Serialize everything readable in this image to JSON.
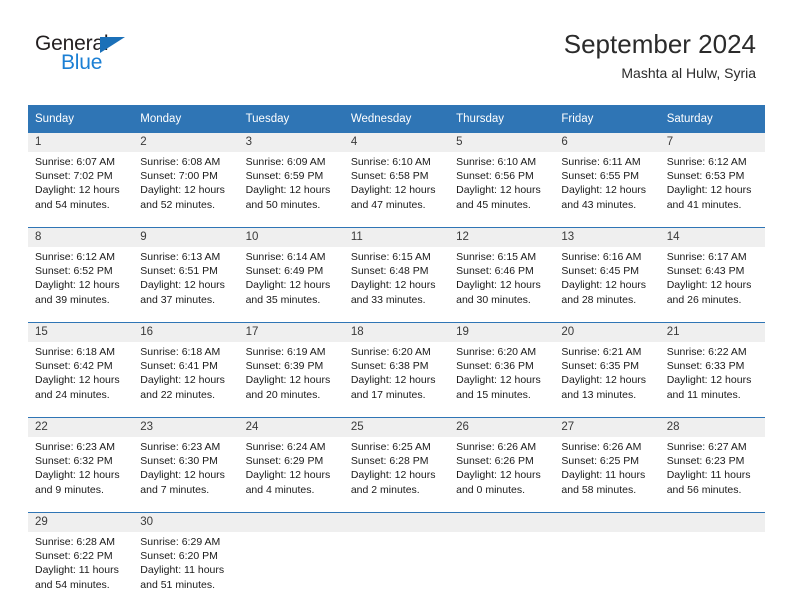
{
  "brand": {
    "name_top": "General",
    "name_bottom": "Blue"
  },
  "header": {
    "month_title": "September 2024",
    "location": "Mashta al Hulw, Syria"
  },
  "colors": {
    "header_blue": "#2f75b5",
    "logo_blue": "#1b7fd4",
    "daynum_band": "#efefef",
    "text": "#1a1a1a"
  },
  "calendar": {
    "weekday_headers": [
      "Sunday",
      "Monday",
      "Tuesday",
      "Wednesday",
      "Thursday",
      "Friday",
      "Saturday"
    ],
    "weeks": [
      {
        "days": [
          {
            "num": "1",
            "sunrise": "Sunrise: 6:07 AM",
            "sunset": "Sunset: 7:02 PM",
            "daylight1": "Daylight: 12 hours",
            "daylight2": "and 54 minutes."
          },
          {
            "num": "2",
            "sunrise": "Sunrise: 6:08 AM",
            "sunset": "Sunset: 7:00 PM",
            "daylight1": "Daylight: 12 hours",
            "daylight2": "and 52 minutes."
          },
          {
            "num": "3",
            "sunrise": "Sunrise: 6:09 AM",
            "sunset": "Sunset: 6:59 PM",
            "daylight1": "Daylight: 12 hours",
            "daylight2": "and 50 minutes."
          },
          {
            "num": "4",
            "sunrise": "Sunrise: 6:10 AM",
            "sunset": "Sunset: 6:58 PM",
            "daylight1": "Daylight: 12 hours",
            "daylight2": "and 47 minutes."
          },
          {
            "num": "5",
            "sunrise": "Sunrise: 6:10 AM",
            "sunset": "Sunset: 6:56 PM",
            "daylight1": "Daylight: 12 hours",
            "daylight2": "and 45 minutes."
          },
          {
            "num": "6",
            "sunrise": "Sunrise: 6:11 AM",
            "sunset": "Sunset: 6:55 PM",
            "daylight1": "Daylight: 12 hours",
            "daylight2": "and 43 minutes."
          },
          {
            "num": "7",
            "sunrise": "Sunrise: 6:12 AM",
            "sunset": "Sunset: 6:53 PM",
            "daylight1": "Daylight: 12 hours",
            "daylight2": "and 41 minutes."
          }
        ]
      },
      {
        "days": [
          {
            "num": "8",
            "sunrise": "Sunrise: 6:12 AM",
            "sunset": "Sunset: 6:52 PM",
            "daylight1": "Daylight: 12 hours",
            "daylight2": "and 39 minutes."
          },
          {
            "num": "9",
            "sunrise": "Sunrise: 6:13 AM",
            "sunset": "Sunset: 6:51 PM",
            "daylight1": "Daylight: 12 hours",
            "daylight2": "and 37 minutes."
          },
          {
            "num": "10",
            "sunrise": "Sunrise: 6:14 AM",
            "sunset": "Sunset: 6:49 PM",
            "daylight1": "Daylight: 12 hours",
            "daylight2": "and 35 minutes."
          },
          {
            "num": "11",
            "sunrise": "Sunrise: 6:15 AM",
            "sunset": "Sunset: 6:48 PM",
            "daylight1": "Daylight: 12 hours",
            "daylight2": "and 33 minutes."
          },
          {
            "num": "12",
            "sunrise": "Sunrise: 6:15 AM",
            "sunset": "Sunset: 6:46 PM",
            "daylight1": "Daylight: 12 hours",
            "daylight2": "and 30 minutes."
          },
          {
            "num": "13",
            "sunrise": "Sunrise: 6:16 AM",
            "sunset": "Sunset: 6:45 PM",
            "daylight1": "Daylight: 12 hours",
            "daylight2": "and 28 minutes."
          },
          {
            "num": "14",
            "sunrise": "Sunrise: 6:17 AM",
            "sunset": "Sunset: 6:43 PM",
            "daylight1": "Daylight: 12 hours",
            "daylight2": "and 26 minutes."
          }
        ]
      },
      {
        "days": [
          {
            "num": "15",
            "sunrise": "Sunrise: 6:18 AM",
            "sunset": "Sunset: 6:42 PM",
            "daylight1": "Daylight: 12 hours",
            "daylight2": "and 24 minutes."
          },
          {
            "num": "16",
            "sunrise": "Sunrise: 6:18 AM",
            "sunset": "Sunset: 6:41 PM",
            "daylight1": "Daylight: 12 hours",
            "daylight2": "and 22 minutes."
          },
          {
            "num": "17",
            "sunrise": "Sunrise: 6:19 AM",
            "sunset": "Sunset: 6:39 PM",
            "daylight1": "Daylight: 12 hours",
            "daylight2": "and 20 minutes."
          },
          {
            "num": "18",
            "sunrise": "Sunrise: 6:20 AM",
            "sunset": "Sunset: 6:38 PM",
            "daylight1": "Daylight: 12 hours",
            "daylight2": "and 17 minutes."
          },
          {
            "num": "19",
            "sunrise": "Sunrise: 6:20 AM",
            "sunset": "Sunset: 6:36 PM",
            "daylight1": "Daylight: 12 hours",
            "daylight2": "and 15 minutes."
          },
          {
            "num": "20",
            "sunrise": "Sunrise: 6:21 AM",
            "sunset": "Sunset: 6:35 PM",
            "daylight1": "Daylight: 12 hours",
            "daylight2": "and 13 minutes."
          },
          {
            "num": "21",
            "sunrise": "Sunrise: 6:22 AM",
            "sunset": "Sunset: 6:33 PM",
            "daylight1": "Daylight: 12 hours",
            "daylight2": "and 11 minutes."
          }
        ]
      },
      {
        "days": [
          {
            "num": "22",
            "sunrise": "Sunrise: 6:23 AM",
            "sunset": "Sunset: 6:32 PM",
            "daylight1": "Daylight: 12 hours",
            "daylight2": "and 9 minutes."
          },
          {
            "num": "23",
            "sunrise": "Sunrise: 6:23 AM",
            "sunset": "Sunset: 6:30 PM",
            "daylight1": "Daylight: 12 hours",
            "daylight2": "and 7 minutes."
          },
          {
            "num": "24",
            "sunrise": "Sunrise: 6:24 AM",
            "sunset": "Sunset: 6:29 PM",
            "daylight1": "Daylight: 12 hours",
            "daylight2": "and 4 minutes."
          },
          {
            "num": "25",
            "sunrise": "Sunrise: 6:25 AM",
            "sunset": "Sunset: 6:28 PM",
            "daylight1": "Daylight: 12 hours",
            "daylight2": "and 2 minutes."
          },
          {
            "num": "26",
            "sunrise": "Sunrise: 6:26 AM",
            "sunset": "Sunset: 6:26 PM",
            "daylight1": "Daylight: 12 hours",
            "daylight2": "and 0 minutes."
          },
          {
            "num": "27",
            "sunrise": "Sunrise: 6:26 AM",
            "sunset": "Sunset: 6:25 PM",
            "daylight1": "Daylight: 11 hours",
            "daylight2": "and 58 minutes."
          },
          {
            "num": "28",
            "sunrise": "Sunrise: 6:27 AM",
            "sunset": "Sunset: 6:23 PM",
            "daylight1": "Daylight: 11 hours",
            "daylight2": "and 56 minutes."
          }
        ]
      },
      {
        "days": [
          {
            "num": "29",
            "sunrise": "Sunrise: 6:28 AM",
            "sunset": "Sunset: 6:22 PM",
            "daylight1": "Daylight: 11 hours",
            "daylight2": "and 54 minutes."
          },
          {
            "num": "30",
            "sunrise": "Sunrise: 6:29 AM",
            "sunset": "Sunset: 6:20 PM",
            "daylight1": "Daylight: 11 hours",
            "daylight2": "and 51 minutes."
          },
          {
            "num": "",
            "sunrise": "",
            "sunset": "",
            "daylight1": "",
            "daylight2": ""
          },
          {
            "num": "",
            "sunrise": "",
            "sunset": "",
            "daylight1": "",
            "daylight2": ""
          },
          {
            "num": "",
            "sunrise": "",
            "sunset": "",
            "daylight1": "",
            "daylight2": ""
          },
          {
            "num": "",
            "sunrise": "",
            "sunset": "",
            "daylight1": "",
            "daylight2": ""
          },
          {
            "num": "",
            "sunrise": "",
            "sunset": "",
            "daylight1": "",
            "daylight2": ""
          }
        ]
      }
    ]
  }
}
